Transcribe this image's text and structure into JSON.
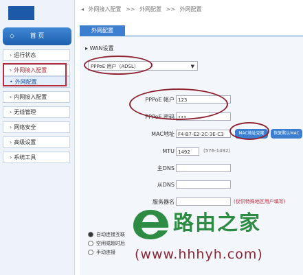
{
  "breadcrumb": [
    "外网接入配置",
    ">>",
    "外网配置",
    ">>",
    "外网配置"
  ],
  "sidebar": {
    "home_label": "首 页",
    "items": [
      {
        "label": "运行状态"
      },
      {
        "label": "外网接入配置"
      },
      {
        "label": "外网配置"
      },
      {
        "label": "内网接入配置"
      },
      {
        "label": "无线管理"
      },
      {
        "label": "网络安全"
      },
      {
        "label": "高级设置"
      },
      {
        "label": "系统工具"
      }
    ]
  },
  "tab": {
    "label": "外网配置"
  },
  "wan": {
    "section_title": "WAN设置",
    "mode_select": "PPPoE 用户（ADSL）",
    "pppoe_account_label": "PPPoE 帐户",
    "pppoe_account_value": "123",
    "pppoe_password_label": "PPPoE 密码",
    "pppoe_password_value": "•••",
    "mac_label": "MAC地址",
    "mac_value": "F4-B7-E2-2C-3E-C3",
    "mac_clone_button": "MAC地址克隆",
    "mac_restore_button": "恢复默认MAC",
    "mtu_label": "MTU",
    "mtu_value": "1492",
    "mtu_hint": "(576-1492)",
    "dns1_label": "主DNS",
    "dns2_label": "从DNS",
    "server_label": "服务器名",
    "server_hint": "(仅供特殊地区用户填写)"
  },
  "connect_modes": [
    {
      "label": "自动连接互联",
      "checked": true
    },
    {
      "label": "空闲或超时后",
      "checked": false
    },
    {
      "label": "手动连接",
      "checked": false
    }
  ],
  "watermark": {
    "brand": "路由之家",
    "url": "(www.hhhyh.com)"
  },
  "colors": {
    "accent": "#3c7fd0",
    "annotation": "#8e2230",
    "watermark_green": "#2e8b43"
  }
}
